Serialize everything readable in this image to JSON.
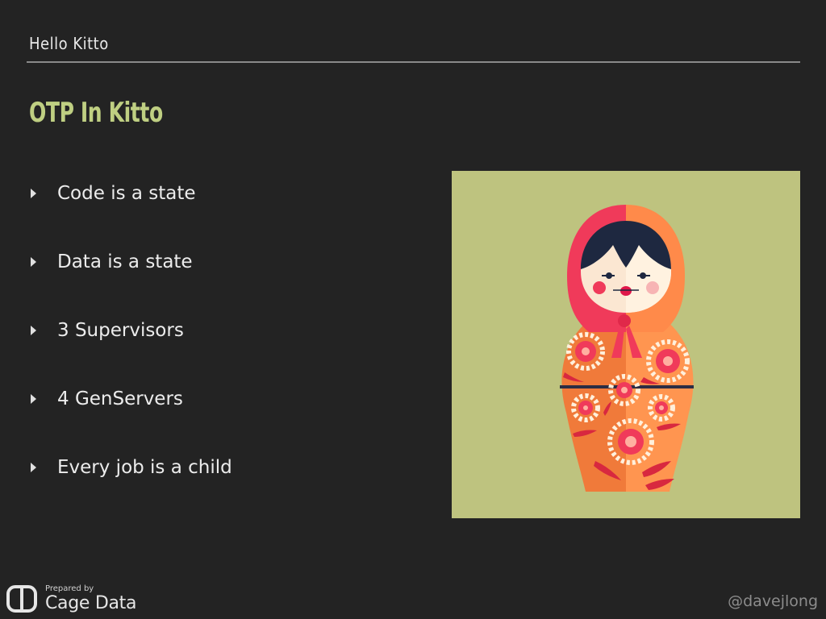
{
  "header": {
    "section": "Hello Kitto",
    "title": "OTP In Kitto"
  },
  "bullets": [
    "Code is a state",
    "Data is a state",
    "3 Supervisors",
    "4 GenServers",
    "Every job is a child"
  ],
  "illustration": {
    "icon": "matryoshka-doll-icon",
    "background": "#bec37f"
  },
  "footer": {
    "prepared_by": "Prepared by",
    "brand": "Cage Data",
    "handle": "@davejlong"
  },
  "colors": {
    "background": "#232323",
    "title_accent": "#bfcf82",
    "doll_red": "#f03a5a",
    "doll_orange": "#ff8a4a"
  }
}
